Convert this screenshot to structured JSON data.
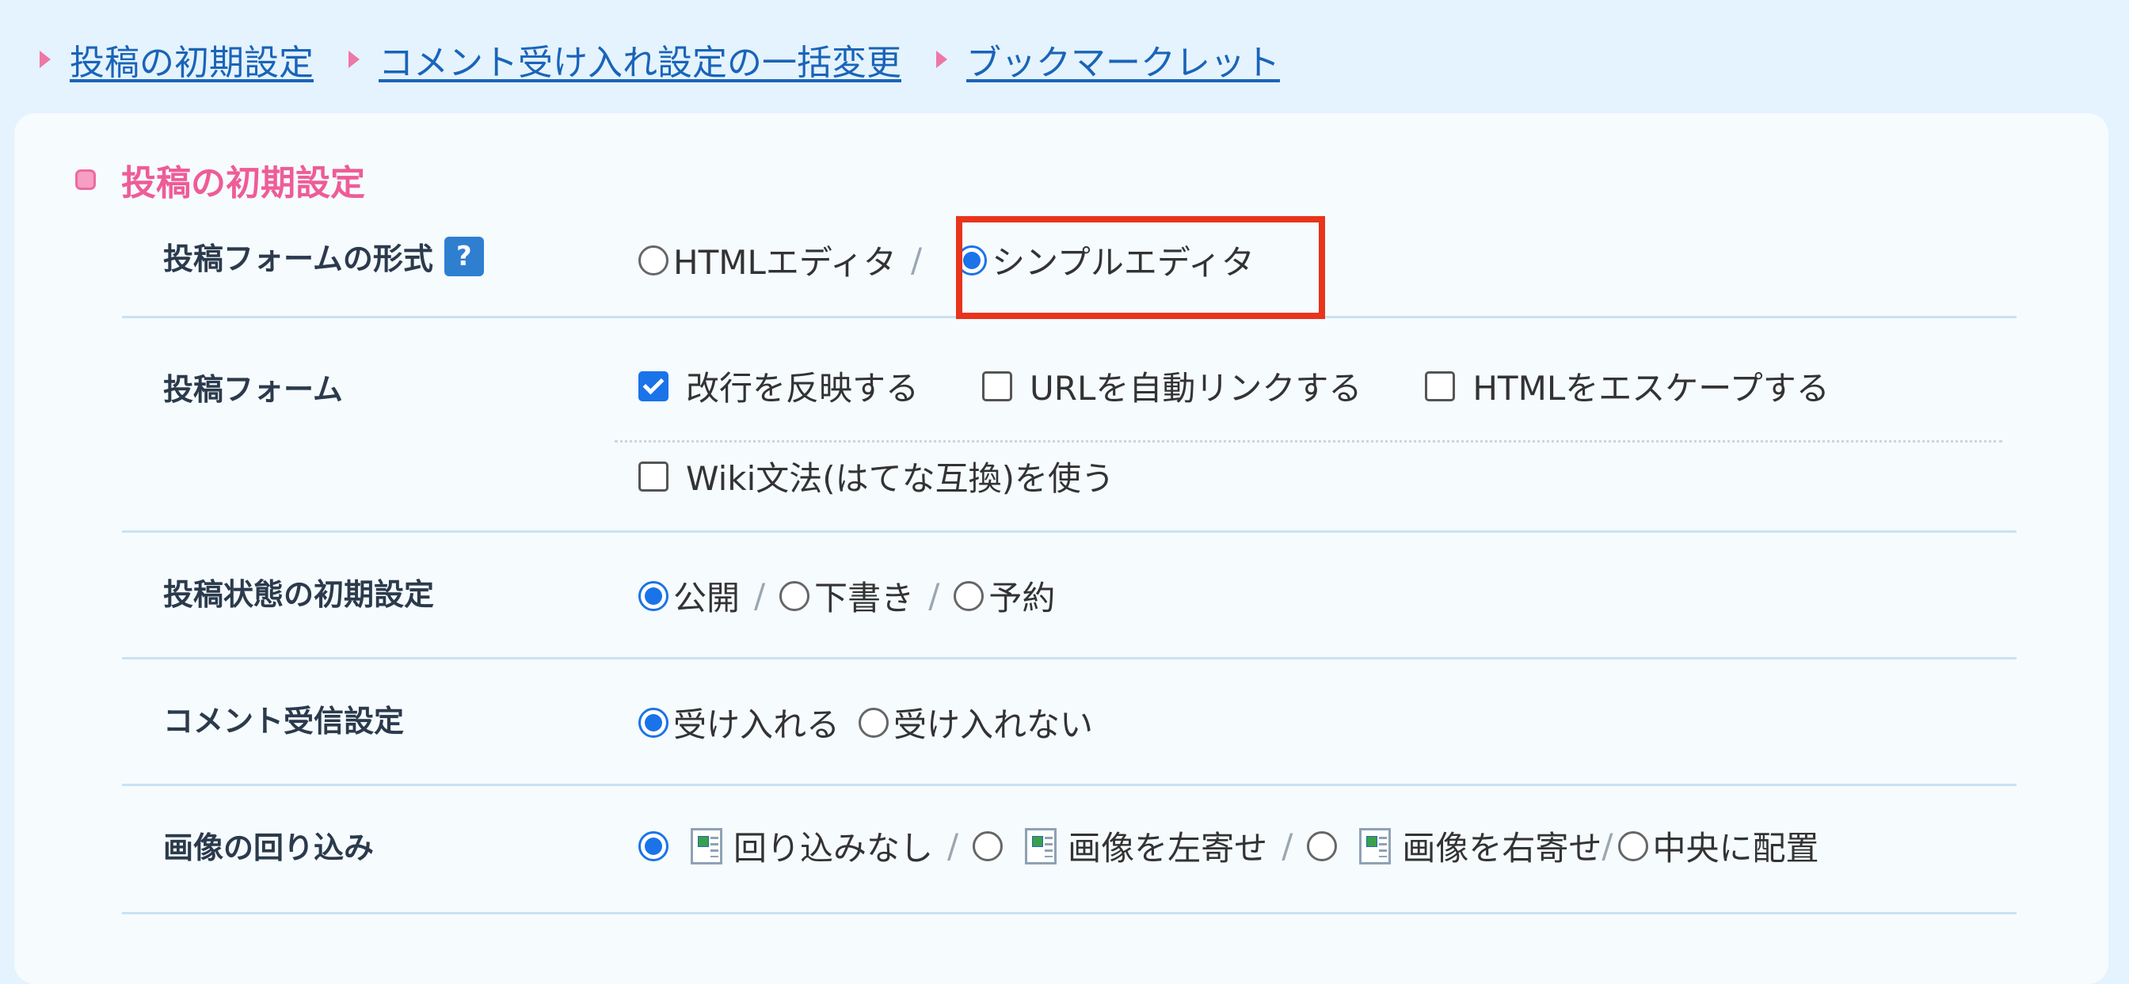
{
  "breadcrumbs": [
    {
      "label": "投稿の初期設定"
    },
    {
      "label": "コメント受け入れ設定の一括変更"
    },
    {
      "label": "ブックマークレット"
    }
  ],
  "section": {
    "title": "投稿の初期設定"
  },
  "rows": {
    "form_type": {
      "label": "投稿フォームの形式",
      "help_icon": "?",
      "options": [
        "HTMLエディタ",
        "シンプルエディタ"
      ],
      "selected": "シンプルエディタ",
      "separator": "/"
    },
    "form": {
      "label": "投稿フォーム",
      "checkboxes": [
        {
          "label": "改行を反映する",
          "checked": true
        },
        {
          "label": "URLを自動リンクする",
          "checked": false
        },
        {
          "label": "HTMLをエスケープする",
          "checked": false
        },
        {
          "label": "Wiki文法(はてな互換)を使う",
          "checked": false
        }
      ]
    },
    "status": {
      "label": "投稿状態の初期設定",
      "options": [
        "公開",
        "下書き",
        "予約"
      ],
      "selected": "公開",
      "separator": "/"
    },
    "comment": {
      "label": "コメント受信設定",
      "options": [
        "受け入れる",
        "受け入れない"
      ],
      "selected": "受け入れる"
    },
    "image_wrap": {
      "label": "画像の回り込み",
      "options": [
        "回り込みなし",
        "画像を左寄せ",
        "画像を右寄せ",
        "中央に配置"
      ],
      "selected": "回り込みなし",
      "separator": "/",
      "icon": "image-layout-icon"
    }
  },
  "colors": {
    "accent_pink": "#ee5c97",
    "link_blue": "#1a64b8",
    "radio_blue": "#1a73e8",
    "highlight_red": "#e8341b",
    "background": "#e4f3fd"
  }
}
